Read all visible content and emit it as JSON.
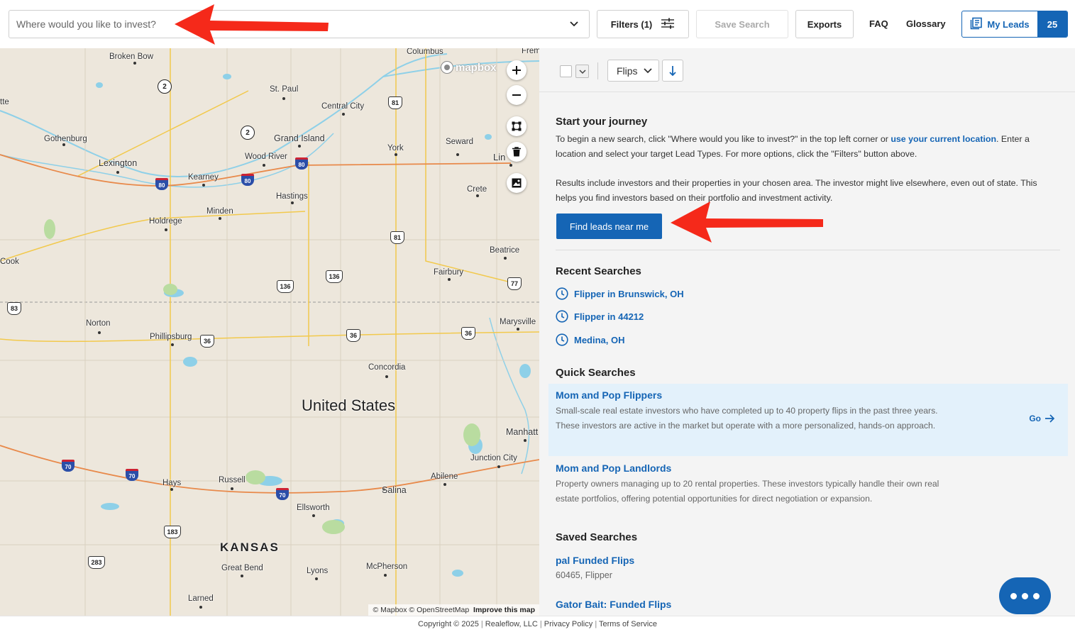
{
  "header": {
    "search_placeholder": "Where would you like to invest?",
    "filters_label": "Filters (1)",
    "save_search_label": "Save Search",
    "exports_label": "Exports",
    "faq_label": "FAQ",
    "glossary_label": "Glossary",
    "my_leads_label": "My Leads",
    "my_leads_count": "25"
  },
  "map": {
    "labels": {
      "broken_bow": "Broken Bow",
      "columbus": "Columbus",
      "fremont": "Frem",
      "st_paul": "St. Paul",
      "central_city": "Central City",
      "tte": "tte",
      "gothenburg": "Gothenburg",
      "grand_island": "Grand Island",
      "york": "York",
      "seward": "Seward",
      "lincoln": "Lin",
      "lexington": "Lexington",
      "wood_river": "Wood River",
      "kearney": "Kearney",
      "crete": "Crete",
      "hastings": "Hastings",
      "minden": "Minden",
      "holdrege": "Holdrege",
      "beatrice": "Beatrice",
      "cook": "Cook",
      "fairbury": "Fairbury",
      "norton": "Norton",
      "marysville": "Marysville",
      "phillipsburg": "Phillipsburg",
      "concordia": "Concordia",
      "united_states": "United States",
      "manhattan": "Manhatt",
      "junction_city": "Junction City",
      "hays": "Hays",
      "russell": "Russell",
      "abilene": "Abilene",
      "salina": "Salina",
      "ellsworth": "Ellsworth",
      "kansas": "KANSAS",
      "great_bend": "Great Bend",
      "lyons": "Lyons",
      "mcpherson": "McPherson",
      "larned": "Larned"
    },
    "shields": {
      "us81a": "81",
      "us81b": "81",
      "us136a": "136",
      "us136b": "136",
      "us77": "77",
      "us83": "83",
      "us36a": "36",
      "us36b": "36",
      "us36c": "36",
      "us183": "183",
      "us283": "283",
      "i80a": "80",
      "i80b": "80",
      "i80c": "80",
      "i70a": "70",
      "i70b": "70",
      "i70c": "70",
      "ne2a": "2",
      "ne2b": "2"
    },
    "logo": "mapbox",
    "attribution": "© Mapbox © OpenStreetMap",
    "improve": "Improve this map"
  },
  "panel": {
    "sort_select": "Flips",
    "journey": {
      "title": "Start your journey",
      "p1_a": "To begin a new search, click \"Where would you like to invest?\" in the top left corner or ",
      "p1_link": "use your current location",
      "p1_b": ". Enter a location and select your target Lead Types. For more options, click the \"Filters\" button above.",
      "p2": "Results include investors and their properties in your chosen area. The investor might live elsewhere, even out of state. This helps you find investors based on their portfolio and investment activity.",
      "find_button": "Find leads near me"
    },
    "recent_title": "Recent Searches",
    "recent": [
      "Flipper in Brunswick, OH",
      "Flipper in 44212",
      "Medina, OH"
    ],
    "quick_title": "Quick Searches",
    "quick": [
      {
        "title": "Mom and Pop Flippers",
        "desc": "Small-scale real estate investors who have completed up to 40 property flips in the past three years. These investors are active in the market but operate with a more personalized, hands-on approach.",
        "go": "Go"
      },
      {
        "title": "Mom and Pop Landlords",
        "desc": "Property owners managing up to 20 rental properties. These investors typically handle their own real estate portfolios, offering potential opportunities for direct negotiation or expansion."
      }
    ],
    "saved_title": "Saved Searches",
    "saved": [
      {
        "title": "pal Funded Flips",
        "sub": "60465, Flipper"
      },
      {
        "title": "Gator Bait: Funded Flips"
      }
    ]
  },
  "footer": {
    "copyright": "Copyright © 2025",
    "company": "Realeflow, LLC",
    "privacy": "Privacy Policy",
    "terms": "Terms of Service"
  },
  "colors": {
    "accent": "#1565b5",
    "annotation_arrow": "#f5291a",
    "map_land": "#ede7dc",
    "water": "#8ed0e8"
  }
}
